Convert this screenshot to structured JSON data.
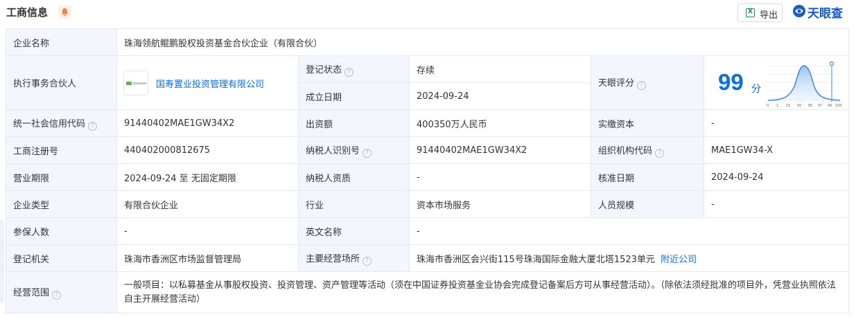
{
  "header": {
    "title": "工商信息",
    "export_label": "导出",
    "brand": "天眼查"
  },
  "colors": {
    "accent": "#0a6fe0",
    "status_green": "#27a65a",
    "label_bg": "#f3f7fd",
    "brand_blue": "#1a5cc6"
  },
  "rows": {
    "company_name_label": "企业名称",
    "company_name": "珠海领航鲲鹏股权投资基金合伙企业（有限合伙）",
    "partner_label": "执行事务合伙人",
    "partner_name": "国寿置业投资管理有限公司",
    "reg_status_label": "登记状态",
    "reg_status": "存续",
    "est_date_label": "成立日期",
    "est_date": "2024-09-24",
    "score_label": "天眼评分",
    "score": "99",
    "score_unit": "分",
    "score_axis": [
      "0",
      "1",
      "15",
      "50",
      "85",
      "97",
      "99",
      "100"
    ],
    "credit_code_label": "统一社会信用代码",
    "credit_code": "91440402MAE1GW34X2",
    "capital_label": "出资额",
    "capital": "400350万人民币",
    "paid_capital_label": "实缴资本",
    "paid_capital": "-",
    "reg_no_label": "工商注册号",
    "reg_no": "440402000812675",
    "taxpayer_id_label": "纳税人识别号",
    "taxpayer_id": "91440402MAE1GW34X2",
    "org_code_label": "组织机构代码",
    "org_code": "MAE1GW34-X",
    "term_label": "营业期限",
    "term": "2024-09-24 至 无固定期限",
    "taxpayer_qual_label": "纳税人资质",
    "taxpayer_qual": "-",
    "approve_date_label": "核准日期",
    "approve_date": "2024-09-24",
    "type_label": "企业类型",
    "type": "有限合伙企业",
    "industry_label": "行业",
    "industry": "资本市场服务",
    "staff_label": "人员规模",
    "staff": "-",
    "insured_label": "参保人数",
    "insured": "-",
    "english_label": "英文名称",
    "english": "-",
    "authority_label": "登记机关",
    "authority": "珠海市香洲区市场监督管理局",
    "address_label": "主要经营场所",
    "address": "珠海市香洲区会兴街115号珠海国际金融大厦北塔1523单元",
    "nearby_link": "附近公司",
    "scope_label": "经营范围",
    "scope": "一般项目：以私募基金从事股权投资、投资管理、资产管理等活动（须在中国证券投资基金业协会完成登记备案后方可从事经营活动）。（除依法须经批准的项目外，凭营业执照依法自主开展经营活动）"
  }
}
